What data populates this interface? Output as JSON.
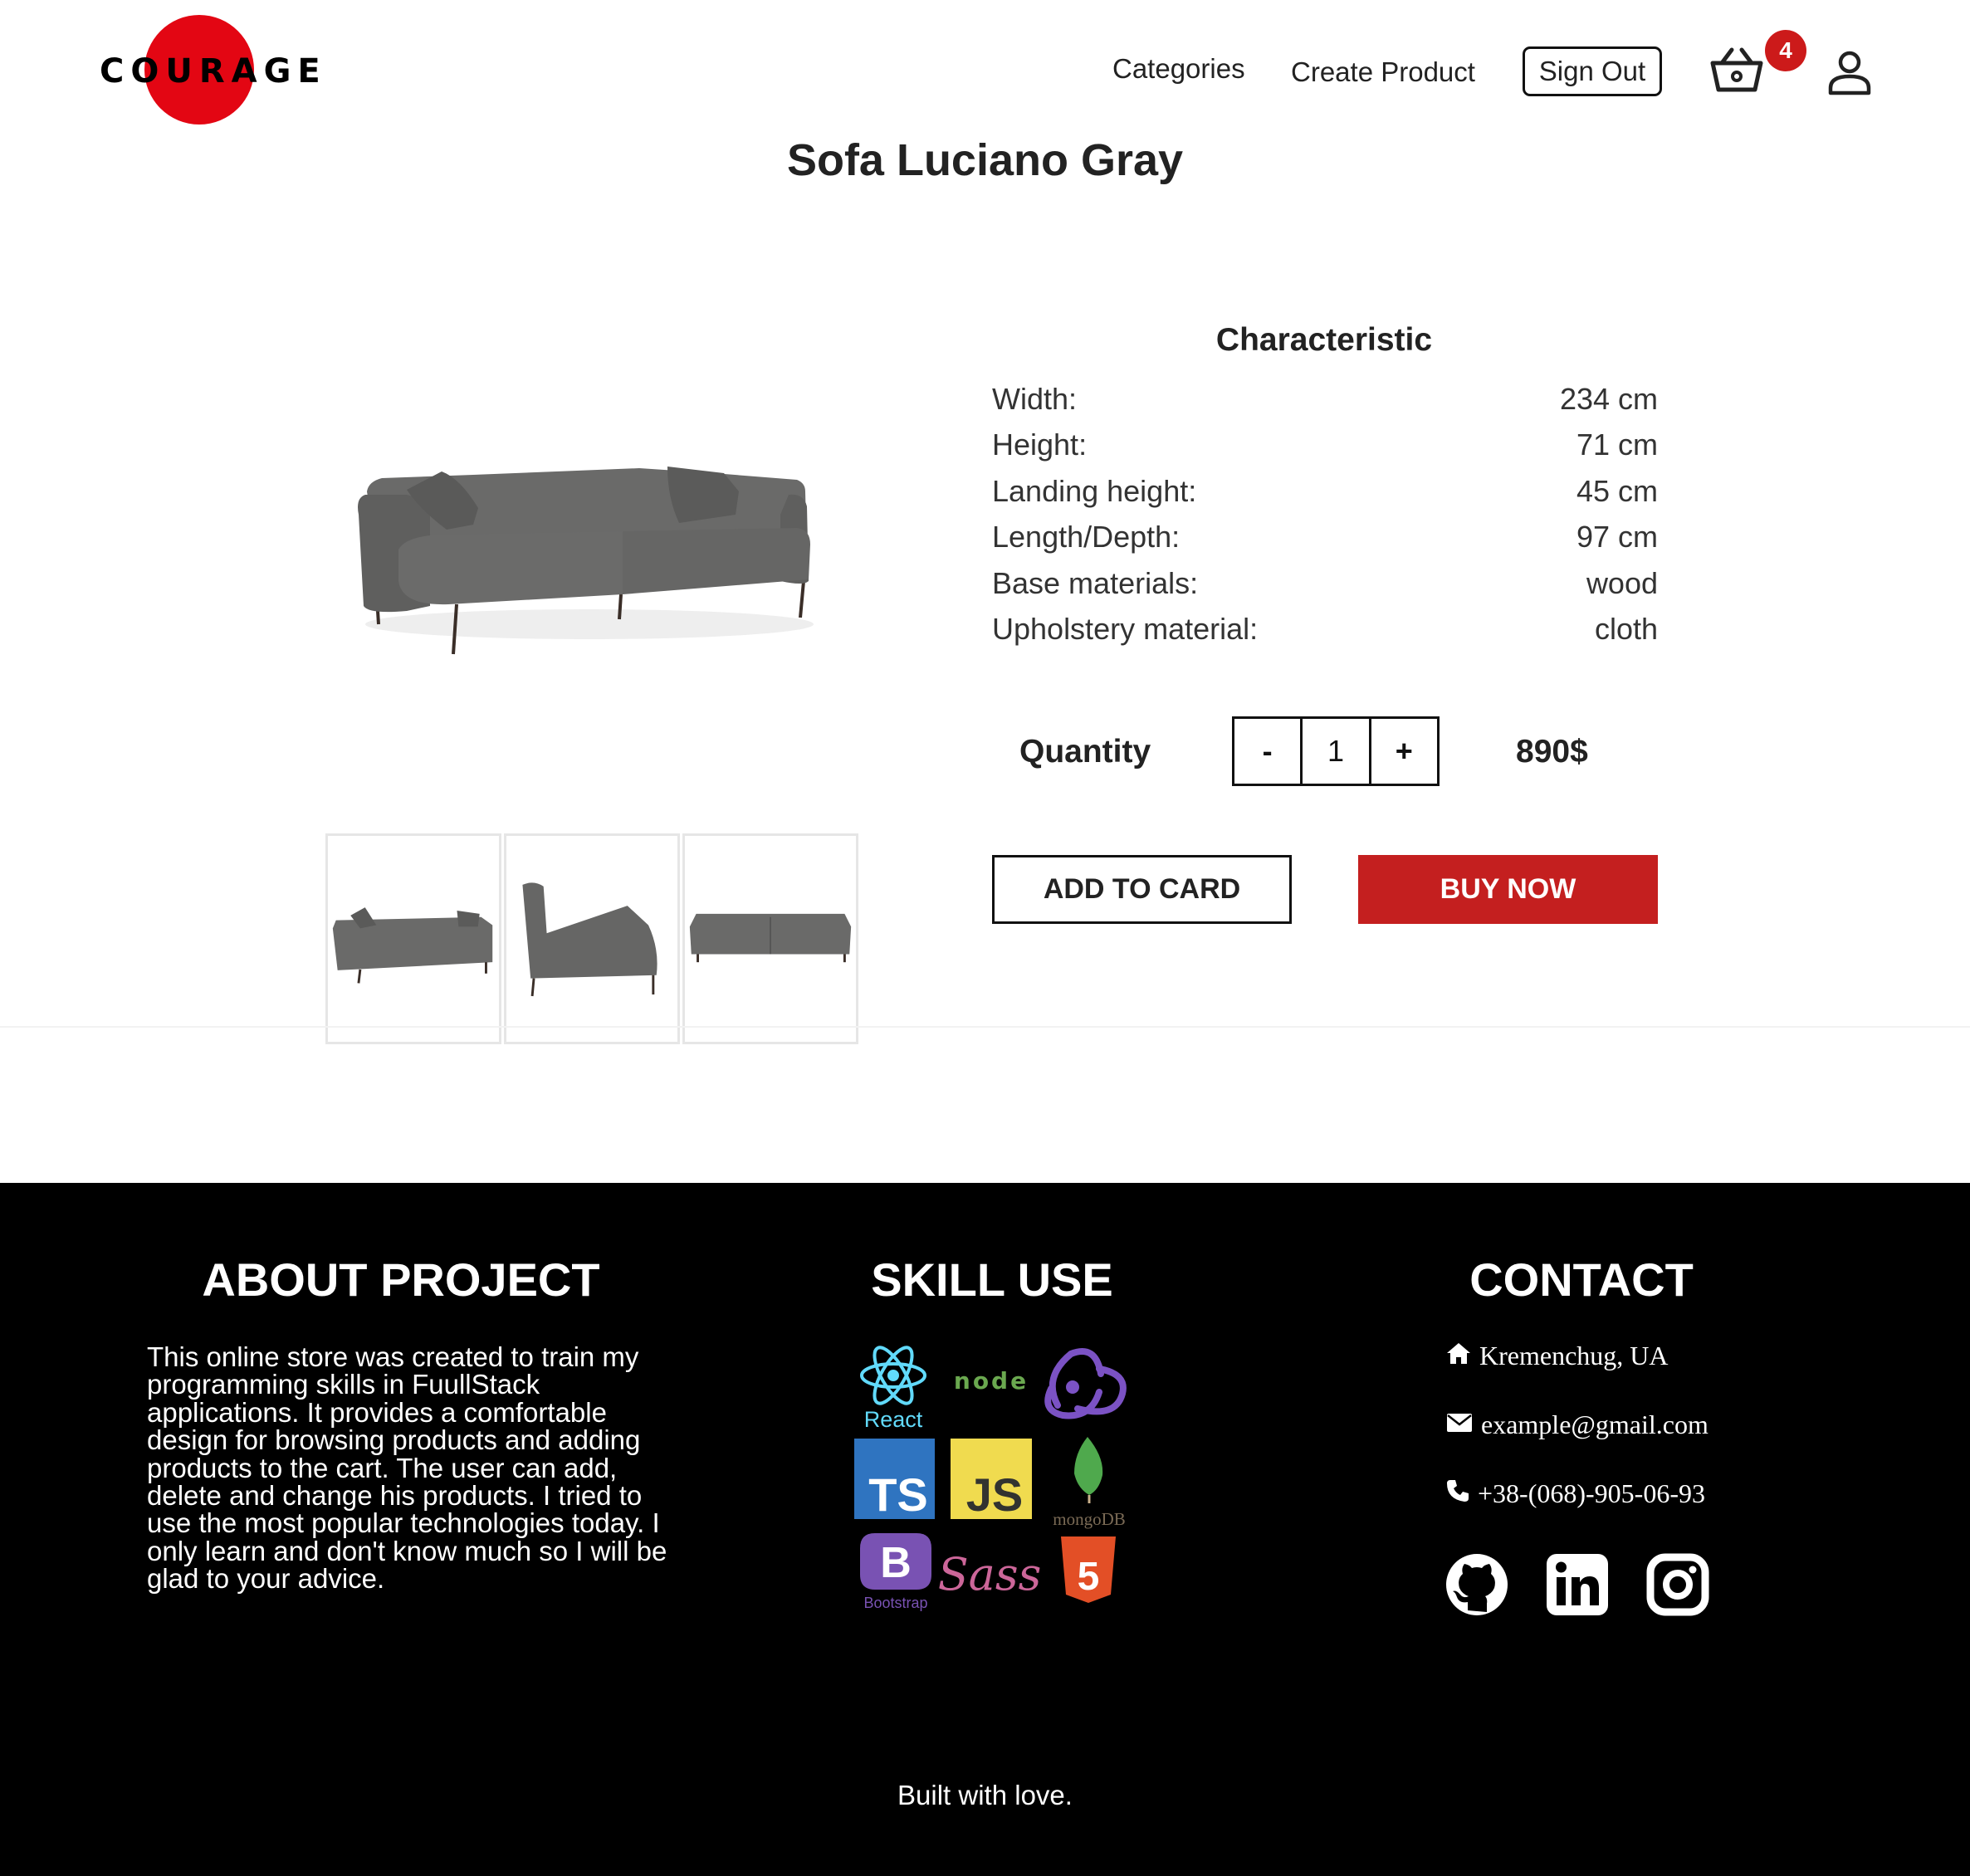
{
  "header": {
    "logo_text": "COURAGE",
    "nav": {
      "categories": "Categories",
      "create_product": "Create Product",
      "sign_out": "Sign Out"
    },
    "cart_count": "4",
    "icons": [
      "basket-icon",
      "user-icon"
    ]
  },
  "product": {
    "title": "Sofa Luciano Gray",
    "thumbnails": [
      "sofa-front-view",
      "sofa-side-view",
      "sofa-back-view"
    ]
  },
  "characteristic": {
    "title": "Characteristic",
    "rows": [
      {
        "label": "Width:",
        "value": "234 cm"
      },
      {
        "label": "Height:",
        "value": "71 cm"
      },
      {
        "label": "Landing height:",
        "value": "45 cm"
      },
      {
        "label": "Length/Depth:",
        "value": "97 cm"
      },
      {
        "label": "Base materials:",
        "value": "wood"
      },
      {
        "label": "Upholstery material:",
        "value": "cloth"
      }
    ]
  },
  "purchase": {
    "quantity_label": "Quantity",
    "minus": "-",
    "quantity": "1",
    "plus": "+",
    "price": "890$",
    "add_to_card": "ADD TO CARD",
    "buy_now": "BUY NOW"
  },
  "footer": {
    "about_title": "ABOUT PROJECT",
    "about_text": "This online store was created to train my programming skills in FuullStack applications. It provides a comfortable design for browsing products and adding products to the cart. The user can add, delete and change his products. I tried to use the most popular technologies today. I only learn and don't know much so I will be glad to your advice.",
    "skill_title": "SKILL USE",
    "skills": {
      "react": "React",
      "node": "node",
      "ts": "TS",
      "js": "JS",
      "mongo": "mongoDB",
      "bootstrap": "Bootstrap",
      "bootstrap_letter": "B",
      "sass": "Sass",
      "html": "5"
    },
    "contact_title": "CONTACT",
    "address": "Kremenchug, UA",
    "email": "example@gmail.com",
    "phone": "+38-(068)-905-06-93",
    "social": [
      "github-icon",
      "linkedin-icon",
      "instagram-icon"
    ],
    "built": "Built with love."
  },
  "colors": {
    "accent_red": "#c41f1f",
    "logo_red": "#e30613",
    "footer_bg": "#000000"
  }
}
